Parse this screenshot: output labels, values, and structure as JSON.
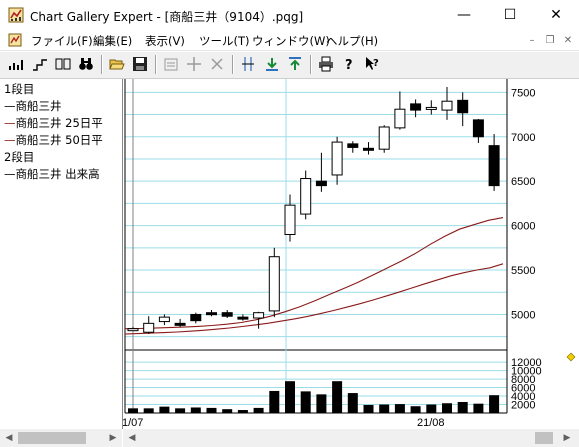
{
  "window": {
    "title": "Chart Gallery Expert - [商船三井（9104）.pqg]",
    "minimize": "—",
    "maximize": "☐",
    "close": "✕"
  },
  "menu": {
    "items": [
      "ファイル(F)",
      "編集(E)",
      "表示(V)",
      "ツール(T)",
      "ウィンドウ(W)",
      "ヘルプ(H)"
    ],
    "mdi_minimize": "–",
    "mdi_restore": "❐",
    "mdi_close": "✕"
  },
  "toolbar": {
    "icons": [
      "bar-chart-icon",
      "step-chart-icon",
      "two-panes-icon",
      "binoculars-icon",
      "open-folder-icon",
      "save-disk-icon",
      "properties-icon",
      "crosshair-icon",
      "delete-x-icon",
      "cursor-lines-icon",
      "download-arrow-icon",
      "upload-arrow-icon",
      "print-icon",
      "help-icon",
      "context-help-icon"
    ]
  },
  "legend": {
    "lines": [
      {
        "prefix": "",
        "text": "1段目",
        "color": "#000000"
      },
      {
        "prefix": "—",
        "text": "商船三井",
        "color": "#000000"
      },
      {
        "prefix": "—",
        "text": "商船三井 25日平",
        "color": "#8b1a1a"
      },
      {
        "prefix": "—",
        "text": "商船三井 50日平",
        "color": "#8b1a1a"
      },
      {
        "prefix": "",
        "text": "2段目",
        "color": "#000000"
      },
      {
        "prefix": "—",
        "text": "商船三井 出来高",
        "color": "#000000"
      }
    ]
  },
  "chart_data": {
    "type": "candlestick",
    "x_labels": [
      "1/07",
      "21/08"
    ],
    "price_axis": {
      "ticks": [
        5000,
        5500,
        6000,
        6500,
        7000,
        7500
      ],
      "tick_labels": [
        "5000",
        "5500",
        "6000",
        "6500",
        "7000",
        "7500"
      ],
      "ylim": [
        4600,
        7650
      ]
    },
    "volume_axis": {
      "ticks": [
        2000,
        4000,
        6000,
        8000,
        10000,
        12000
      ],
      "tick_labels": [
        "2000",
        "4000",
        "6000",
        "8000",
        "10000",
        "12000"
      ],
      "ylim": [
        0,
        12500
      ]
    },
    "candles": [
      {
        "open": 4840,
        "close": 4840,
        "high": 4860,
        "low": 4820
      },
      {
        "open": 4800,
        "close": 4900,
        "high": 4980,
        "low": 4780
      },
      {
        "open": 4920,
        "close": 4970,
        "high": 5000,
        "low": 4880
      },
      {
        "open": 4900,
        "close": 4880,
        "high": 4950,
        "low": 4860
      },
      {
        "open": 5000,
        "close": 4930,
        "high": 5020,
        "low": 4900
      },
      {
        "open": 5020,
        "close": 5000,
        "high": 5050,
        "low": 4980
      },
      {
        "open": 5020,
        "close": 4980,
        "high": 5050,
        "low": 4960
      },
      {
        "open": 4970,
        "close": 4960,
        "high": 5000,
        "low": 4930
      },
      {
        "open": 4960,
        "close": 5020,
        "high": 5030,
        "low": 4840
      },
      {
        "open": 5040,
        "close": 5650,
        "high": 5750,
        "low": 4970
      },
      {
        "open": 5900,
        "close": 6230,
        "high": 6350,
        "low": 5820
      },
      {
        "open": 6130,
        "close": 6530,
        "high": 6620,
        "low": 6070
      },
      {
        "open": 6500,
        "close": 6450,
        "high": 6820,
        "low": 6380
      },
      {
        "open": 6570,
        "close": 6940,
        "high": 7000,
        "low": 6460
      },
      {
        "open": 6920,
        "close": 6880,
        "high": 6950,
        "low": 6820
      },
      {
        "open": 6870,
        "close": 6850,
        "high": 6940,
        "low": 6800
      },
      {
        "open": 6860,
        "close": 7110,
        "high": 7130,
        "low": 6820
      },
      {
        "open": 7100,
        "close": 7310,
        "high": 7510,
        "low": 7080
      },
      {
        "open": 7370,
        "close": 7300,
        "high": 7420,
        "low": 7220
      },
      {
        "open": 7330,
        "close": 7330,
        "high": 7410,
        "low": 7250
      },
      {
        "open": 7300,
        "close": 7400,
        "high": 7560,
        "low": 7190
      },
      {
        "open": 7410,
        "close": 7270,
        "high": 7500,
        "low": 7120
      },
      {
        "open": 7190,
        "close": 7000,
        "high": 7200,
        "low": 6930
      },
      {
        "open": 6900,
        "close": 6450,
        "high": 7030,
        "low": 6390
      }
    ],
    "ma25": [
      4840,
      4842,
      4846,
      4852,
      4858,
      4866,
      4876,
      4890,
      4910,
      4940,
      4980,
      5030,
      5085,
      5150,
      5220,
      5290,
      5360,
      5440,
      5520,
      5600,
      5690,
      5790,
      5880,
      5960,
      6010,
      6060,
      6090
    ],
    "ma50": [
      4780,
      4785,
      4790,
      4796,
      4803,
      4812,
      4822,
      4834,
      4848,
      4864,
      4882,
      4902,
      4925,
      4950,
      4978,
      5010,
      5045,
      5082,
      5120,
      5162,
      5205,
      5250,
      5298,
      5345,
      5390,
      5435,
      5470,
      5500,
      5525,
      5570
    ],
    "volume": [
      1100,
      1100,
      1500,
      1100,
      1300,
      1200,
      900,
      700,
      1200,
      5200,
      7500,
      5100,
      4400,
      7500,
      4700,
      1900,
      2000,
      2100,
      1600,
      2000,
      2300,
      2600,
      2200,
      4200
    ]
  }
}
